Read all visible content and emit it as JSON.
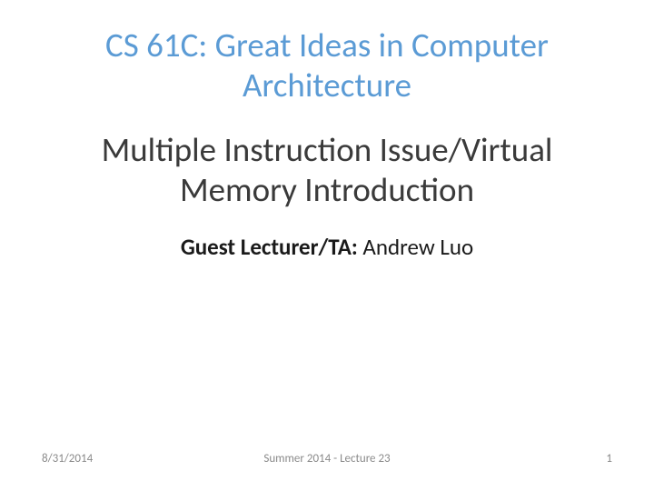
{
  "course_title": "CS 61C: Great Ideas in Computer Architecture",
  "lecture_title": "Multiple Instruction Issue/Virtual Memory Introduction",
  "lecturer": {
    "label": "Guest Lecturer/TA: ",
    "name": "Andrew Luo"
  },
  "footer": {
    "date": "8/31/2014",
    "session": "Summer 2014 - Lecture 23",
    "page": "1"
  }
}
